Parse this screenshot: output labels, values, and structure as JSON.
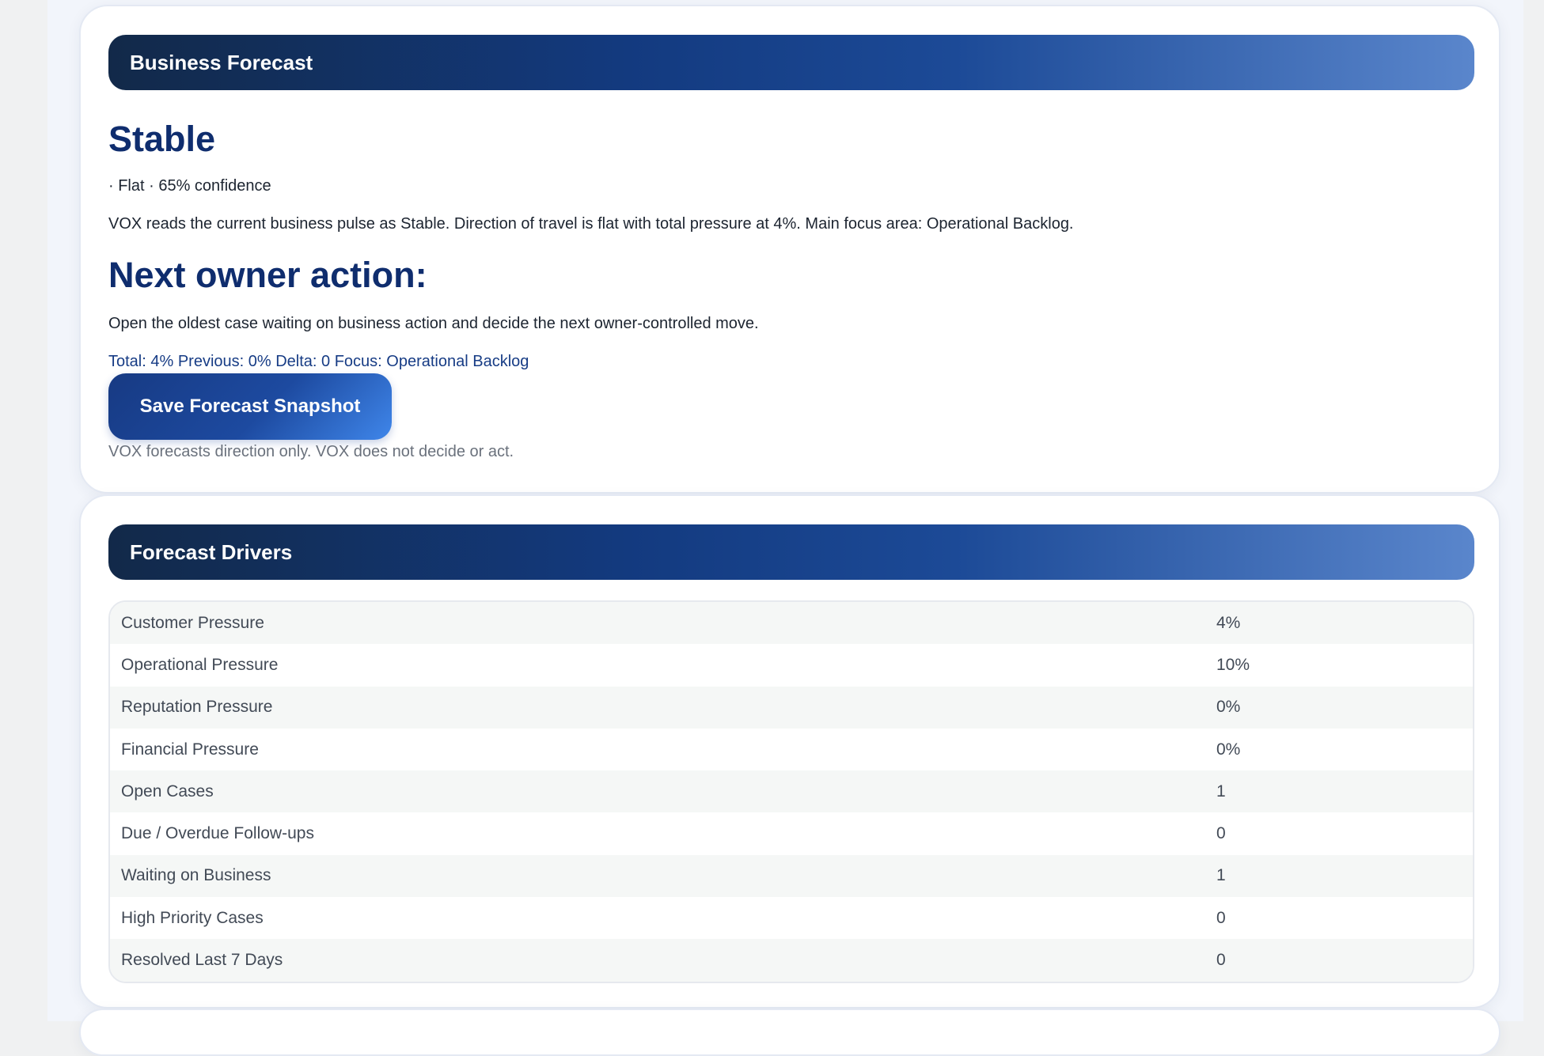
{
  "forecast": {
    "header": "Business Forecast",
    "status": "Stable",
    "meta": "· Flat · 65% confidence",
    "summary": "VOX reads the current business pulse as Stable. Direction of travel is flat with total pressure at 4%. Main focus area: Operational Backlog.",
    "action_title": "Next owner action:",
    "action_text": "Open the oldest case waiting on business action and decide the next owner-controlled move.",
    "metrics_line": "Total: 4% Previous: 0% Delta: 0 Focus: Operational Backlog",
    "save_label": "Save Forecast Snapshot",
    "disclaimer": "VOX forecasts direction only. VOX does not decide or act."
  },
  "drivers": {
    "header": "Forecast Drivers",
    "rows": [
      {
        "label": "Customer Pressure",
        "value": "4%"
      },
      {
        "label": "Operational Pressure",
        "value": "10%"
      },
      {
        "label": "Reputation Pressure",
        "value": "0%"
      },
      {
        "label": "Financial Pressure",
        "value": "0%"
      },
      {
        "label": "Open Cases",
        "value": "1"
      },
      {
        "label": "Due / Overdue Follow-ups",
        "value": "0"
      },
      {
        "label": "Waiting on Business",
        "value": "1"
      },
      {
        "label": "High Priority Cases",
        "value": "0"
      },
      {
        "label": "Resolved Last 7 Days",
        "value": "0"
      }
    ]
  }
}
